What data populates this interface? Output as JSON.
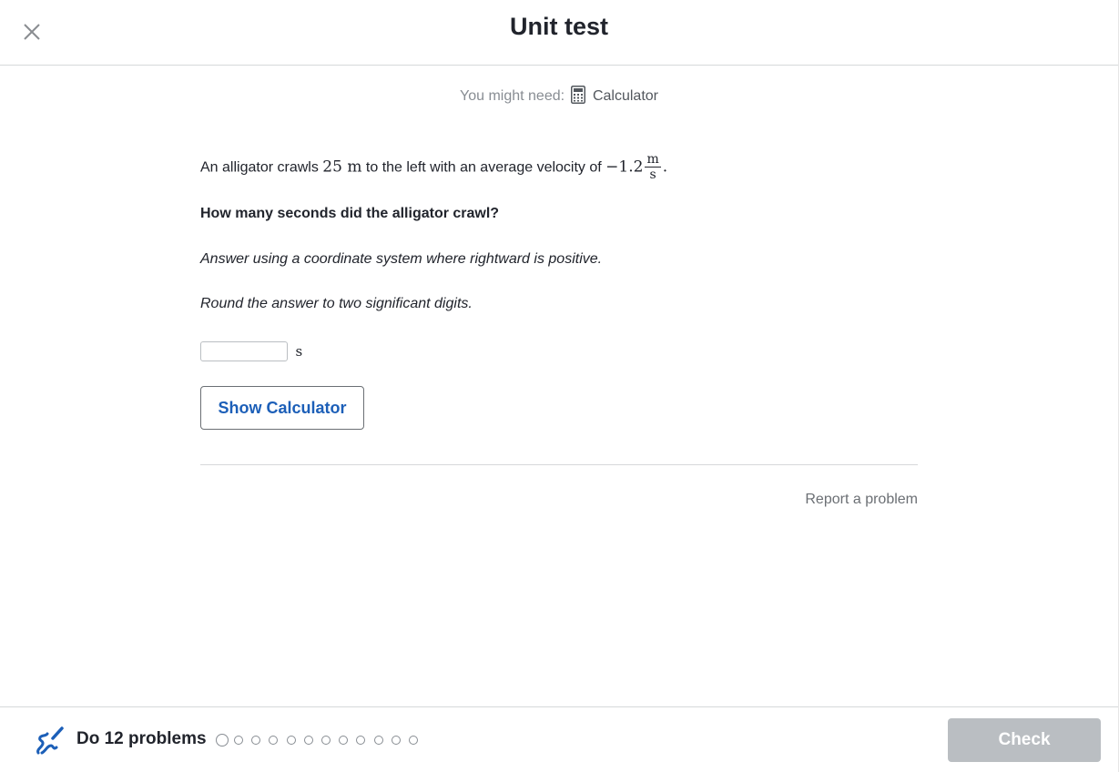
{
  "header": {
    "title": "Unit test",
    "close_icon": "close-icon"
  },
  "needs": {
    "prefix": "You might need:",
    "tool_icon": "calculator-icon",
    "tool_label": "Calculator"
  },
  "problem": {
    "text_before": "An alligator crawls ",
    "distance_value": "25",
    "distance_unit": "m",
    "text_middle": " to the left with an average velocity of ",
    "velocity_value": "−1.2",
    "velocity_unit_numerator": "m",
    "velocity_unit_denominator": "s",
    "text_end": ".",
    "question": "How many seconds did the alligator crawl?",
    "hint_coordinate": "Answer using a coordinate system where rightward is positive.",
    "hint_rounding": "Round the answer to two significant digits.",
    "answer_value": "",
    "answer_unit": "s",
    "show_calculator_label": "Show Calculator",
    "report_label": "Report a problem"
  },
  "footer": {
    "icon": "pencil-squiggle-icon",
    "label": "Do 12 problems",
    "total_problems": 12,
    "current_problem": 1,
    "check_label": "Check",
    "check_enabled": false
  },
  "colors": {
    "accent": "#1c5fb8",
    "text": "#21242c",
    "muted": "#888d93",
    "check_disabled": "#babec2",
    "divider": "#d6d8da"
  }
}
